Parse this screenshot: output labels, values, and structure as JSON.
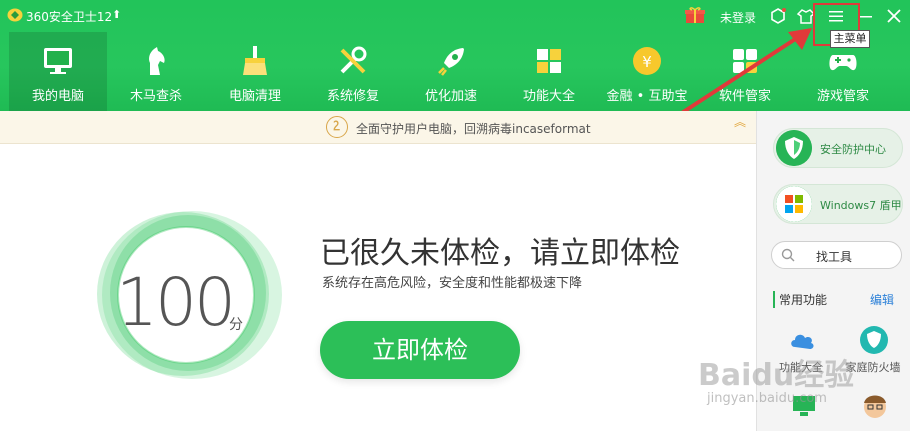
{
  "app": {
    "title": "360安全卫士12",
    "login": "未登录",
    "tooltip": "主菜单"
  },
  "nav": [
    {
      "label": "我的电脑",
      "icon": "monitor-icon"
    },
    {
      "label": "木马查杀",
      "icon": "horse-icon"
    },
    {
      "label": "电脑清理",
      "icon": "broom-icon"
    },
    {
      "label": "系统修复",
      "icon": "wrench-icon"
    },
    {
      "label": "优化加速",
      "icon": "rocket-icon"
    },
    {
      "label": "功能大全",
      "icon": "grid-icon"
    },
    {
      "label": "金融 • 互助宝",
      "icon": "coin-icon"
    },
    {
      "label": "软件管家",
      "icon": "apps-icon"
    },
    {
      "label": "游戏管家",
      "icon": "gamepad-icon"
    }
  ],
  "infobar": {
    "text": "全面守护用户电脑，回溯病毒incaseformat"
  },
  "main": {
    "score": "100",
    "unit": "分",
    "headline": "已很久未体检，请立即体检",
    "subline": "系统存在高危风险，安全度和性能都极速下降",
    "button": "立即体检"
  },
  "sidebar": {
    "security_center": "安全防护中心",
    "win7_shield": "Windows7 盾甲",
    "search_placeholder": "找工具",
    "common_title": "常用功能",
    "edit": "编辑",
    "tools": [
      {
        "label": "功能大全"
      },
      {
        "label": "家庭防火墙"
      }
    ]
  },
  "watermark": {
    "brand": "Baidu经验",
    "url": "jingyan.baidu.com"
  },
  "colors": {
    "brand_green": "#27c65d",
    "button_green": "#2cbf58",
    "highlight_red": "#e03a3a"
  }
}
